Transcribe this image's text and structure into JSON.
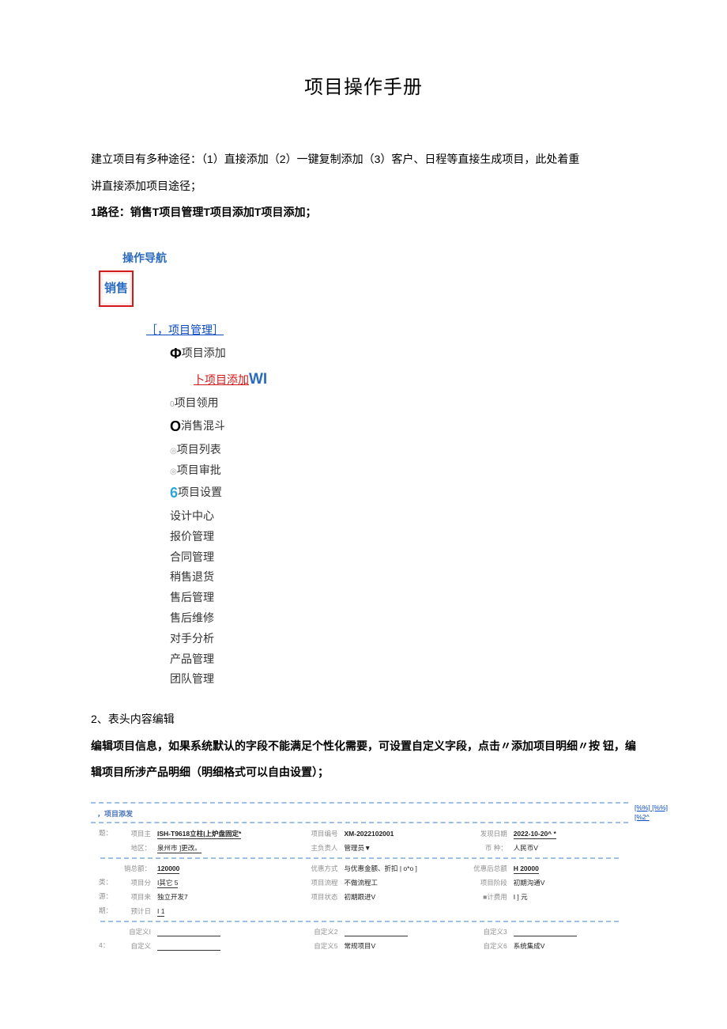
{
  "title": "项目操作手册",
  "intro1": "建立项目有多种途径：（1）直接添加（2）一键复制添加（3）客户、日程等直接生成项目，此处着重",
  "intro2": "讲直接添加项目途径；",
  "step1_label": "1路径：销售T项目管理T项目添加T项目添加；",
  "nav_title": "操作导航",
  "sales_box": "销售",
  "tree": {
    "proj_mgmt": "［，项目管理］",
    "proj_add": "项目添加",
    "proj_add_sub": "卜项目添加",
    "wi": "WI",
    "proj_receive": "项目领用",
    "sales_funnel": "消售混斗",
    "proj_list": "项目列表",
    "proj_approve": "项目审批",
    "proj_setting": "项目设置",
    "design_center": "设计中心",
    "quote_mgmt": "报价管理",
    "contract_mgmt": "合同管理",
    "sales_return": "稍售退货",
    "aftersales_mgmt": "售后管理",
    "aftersales_repair": "售后维修",
    "competitor": "对手分析",
    "product_mgmt": "产品管理",
    "team_mgmt": "团队管理"
  },
  "step2_label": "2、表头内容编辑",
  "step2_body": "编辑项目信息，如果系统默认的字段不能满足个性化需要，可设置自定义字段，点击〃添加项目明细〃按 钮，编辑项目所涉产品明细（明细格式可以自由设置）；",
  "form": {
    "header": "，项目添发",
    "right_links": [
      "[%%] [%%]",
      "[%2^"
    ],
    "rows": {
      "r1": {
        "side": "题：",
        "c1_lab": "项目主",
        "c1_val": "ISH-T9618立柱|上炉盘固定*",
        "c2_lab": "项目编号",
        "c2_val": "XM-2022102001",
        "c3_lab": "发现日期",
        "c3_val": "2022-10-20^ *"
      },
      "r1b": {
        "c1_lab": "地区：",
        "c1_val": "泉州市    ]更改。",
        "c2_lab": "主负责人",
        "c2_val": "管理员▼",
        "c3_lab": "币 种：",
        "c3_val": "人民币V"
      },
      "r2": {
        "c1_lab": "销总额：",
        "c1_val": "120000",
        "c2_lab": "优惠方式",
        "c2_val": "与优惠金额、折扣 | o*o      ]",
        "c3_lab": "优惠后总额",
        "c3_val": "H 20000"
      },
      "r3": {
        "side": "类：",
        "c1_lab": "项目分",
        "c1_val": "I其它 5",
        "c2_lab": "项目流程",
        "c2_val": "不做流程工",
        "c3_lab": "项目阶段",
        "c3_val": "初期沟通V"
      },
      "r4": {
        "side": "源：",
        "c1_lab": "项目来",
        "c1_val": "独立开发7",
        "c2_lab": "项目状态",
        "c2_val": "初期跟进V",
        "c3_lab": "■计费用",
        "c3_val": "I           ] 元"
      },
      "r5": {
        "side": "期：",
        "c1_lab": "预计日",
        "c1_val": "I           1"
      },
      "r6": {
        "c1_lab": "自定义I",
        "c1_val": "",
        "c2_lab": "自定义2",
        "c2_val": "",
        "c3_lab": "自定义3",
        "c3_val": ""
      },
      "r7": {
        "side": "4：",
        "c1_lab": "自定义",
        "c1_val": "",
        "c2_lab": "自定义5",
        "c2_val": "常规项目V",
        "c3_lab": "自定义6",
        "c3_val": "系统集成V"
      }
    }
  }
}
